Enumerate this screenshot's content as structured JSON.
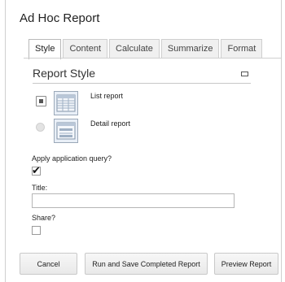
{
  "dialog": {
    "title": "Ad Hoc Report"
  },
  "tabs": [
    {
      "label": "Style",
      "active": true
    },
    {
      "label": "Content",
      "active": false
    },
    {
      "label": "Calculate",
      "active": false
    },
    {
      "label": "Summarize",
      "active": false
    },
    {
      "label": "Format",
      "active": false
    }
  ],
  "report_style": {
    "title": "Report Style",
    "options": [
      {
        "label": "List report",
        "selected": true,
        "icon": "list-report-icon"
      },
      {
        "label": "Detail report",
        "selected": false,
        "icon": "detail-report-icon"
      }
    ]
  },
  "apply_query": {
    "label": "Apply application query?",
    "checked": true
  },
  "title_field": {
    "label": "Title:",
    "value": ""
  },
  "share": {
    "label": "Share?",
    "checked": false
  },
  "buttons": {
    "cancel": "Cancel",
    "run_save": "Run and Save Completed Report",
    "preview": "Preview Report"
  },
  "colors": {
    "accent_thumb": "#e9eff7",
    "thumb_border": "#9aa8b8",
    "button_border": "#c9c9c9"
  }
}
